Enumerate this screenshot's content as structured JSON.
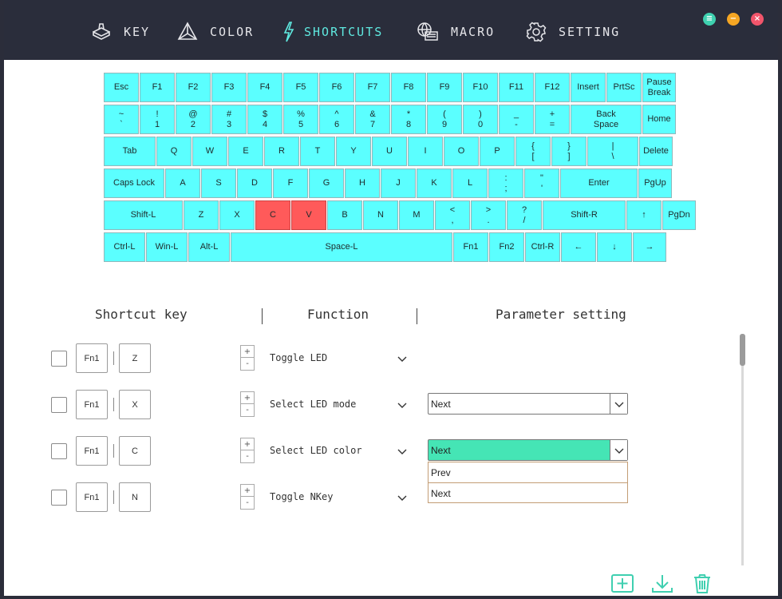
{
  "nav": [
    {
      "label": "KEY",
      "icon": "key-icon"
    },
    {
      "label": "COLOR",
      "icon": "color-icon"
    },
    {
      "label": "SHORTCUTS",
      "icon": "lightning-icon"
    },
    {
      "label": "MACRO",
      "icon": "macro-icon"
    },
    {
      "label": "SETTING",
      "icon": "gear-icon"
    }
  ],
  "window_buttons": {
    "menu": "≡",
    "minimize": "−",
    "close": "×"
  },
  "colors": {
    "key": "#5bffff",
    "selected_key": "#ff5a5a",
    "accent": "#5fe9e0",
    "active_select": "#45e5b5",
    "topbar": "#2a2d3b"
  },
  "keyboard": {
    "rows": [
      [
        "Esc",
        "F1",
        "F2",
        "F3",
        "F4",
        "F5",
        "F6",
        "F7",
        "F8",
        "F9",
        "F10",
        "F11",
        "F12",
        "Insert",
        "PrtSc",
        "Pause\nBreak"
      ],
      [
        "~\n`",
        "!\n1",
        "@\n2",
        "#\n3",
        "$\n4",
        "%\n5",
        "^\n6",
        "&\n7",
        "*\n8",
        "(\n9",
        ")\n0",
        "_\n-",
        "+\n=",
        "Back\nSpace",
        "Home"
      ],
      [
        "Tab",
        "Q",
        "W",
        "E",
        "R",
        "T",
        "Y",
        "U",
        "I",
        "O",
        "P",
        "{\n[",
        "}\n]",
        "|\n\\",
        "Delete"
      ],
      [
        "Caps Lock",
        "A",
        "S",
        "D",
        "F",
        "G",
        "H",
        "J",
        "K",
        "L",
        ":\n;",
        "\"\n'",
        "Enter",
        "PgUp"
      ],
      [
        "Shift-L",
        "Z",
        "X",
        "C",
        "V",
        "B",
        "N",
        "M",
        "<\n,",
        ">\n.",
        "?\n/",
        "Shift-R",
        "↑",
        "PgDn"
      ],
      [
        "Ctrl-L",
        "Win-L",
        "Alt-L",
        "Space-L",
        "Fn1",
        "Fn2",
        "Ctrl-R",
        "←",
        "↓",
        "→"
      ]
    ],
    "selected": [
      "C",
      "V"
    ]
  },
  "columns": {
    "shortcut": "Shortcut key",
    "function": "Function",
    "parameter": "Parameter setting"
  },
  "shortcuts": [
    {
      "mod": "Fn1",
      "key": "Z",
      "function": "Toggle LED",
      "param": null
    },
    {
      "mod": "Fn1",
      "key": "X",
      "function": "Select LED mode",
      "param": "Next"
    },
    {
      "mod": "Fn1",
      "key": "C",
      "function": "Select LED color",
      "param": "Next"
    },
    {
      "mod": "Fn1",
      "key": "N",
      "function": "Toggle NKey",
      "param": null
    }
  ],
  "dropdown_options": [
    "Prev",
    "Next"
  ],
  "stepper": {
    "plus": "+",
    "minus": "-"
  }
}
